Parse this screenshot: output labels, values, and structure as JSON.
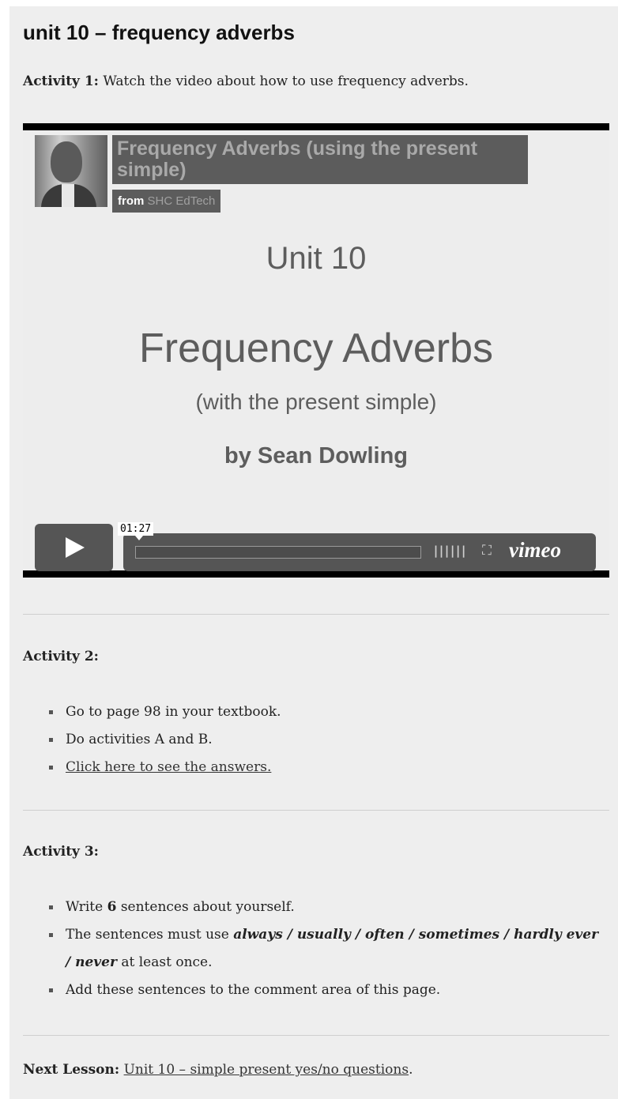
{
  "page": {
    "title": "unit 10 – frequency adverbs"
  },
  "activity1": {
    "label": "Activity 1:",
    "text": "Watch the video about how to use frequency adverbs."
  },
  "video": {
    "title": "Frequency Adverbs (using the present simple)",
    "from_label": "from",
    "channel": "SHC EdTech",
    "slide": {
      "line1": "Unit 10",
      "line2": "Frequency Adverbs",
      "line3": "(with the present simple)",
      "line4": "by Sean Dowling"
    },
    "time": "01:27",
    "brand": "vimeo",
    "icons": [
      "play-icon",
      "volume-icon",
      "fullscreen-icon"
    ]
  },
  "activity2": {
    "label": "Activity 2:",
    "items": [
      "Go to page 98 in your textbook.",
      "Do activities A and B.",
      "Click here to see the answers."
    ]
  },
  "activity3": {
    "label": "Activity 3:",
    "item1": {
      "pre": "Write ",
      "bold": "6",
      "post": " sentences about yourself."
    },
    "item2": {
      "pre": "The sentences must use ",
      "emph": "always / usually / often / sometimes / hardly ever / never",
      "post": " at least once."
    },
    "item3": "Add these sentences to the comment area of this page."
  },
  "next": {
    "label": "Next Lesson:",
    "link": "Unit 10 – simple present yes/no questions",
    "suffix": "."
  }
}
